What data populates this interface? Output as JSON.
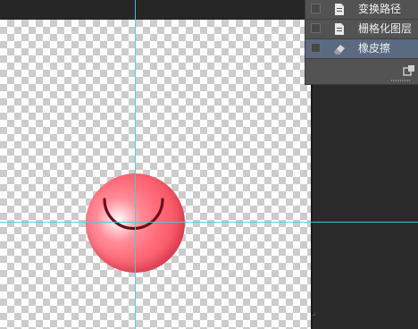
{
  "layers_panel": {
    "layers": [
      {
        "label": "变换路径",
        "icon": "path-document-icon",
        "selected": false
      },
      {
        "label": "栅格化图层",
        "icon": "path-document-icon",
        "selected": false
      },
      {
        "label": "橡皮擦",
        "icon": "eraser-icon",
        "selected": true
      }
    ],
    "new_snapshot_icon": "new-document-icon"
  },
  "colors": {
    "guide": "#3ad4e6",
    "selection": "#5a6a80",
    "ball": "#ff6b7a",
    "smile": "#6e0d17"
  }
}
